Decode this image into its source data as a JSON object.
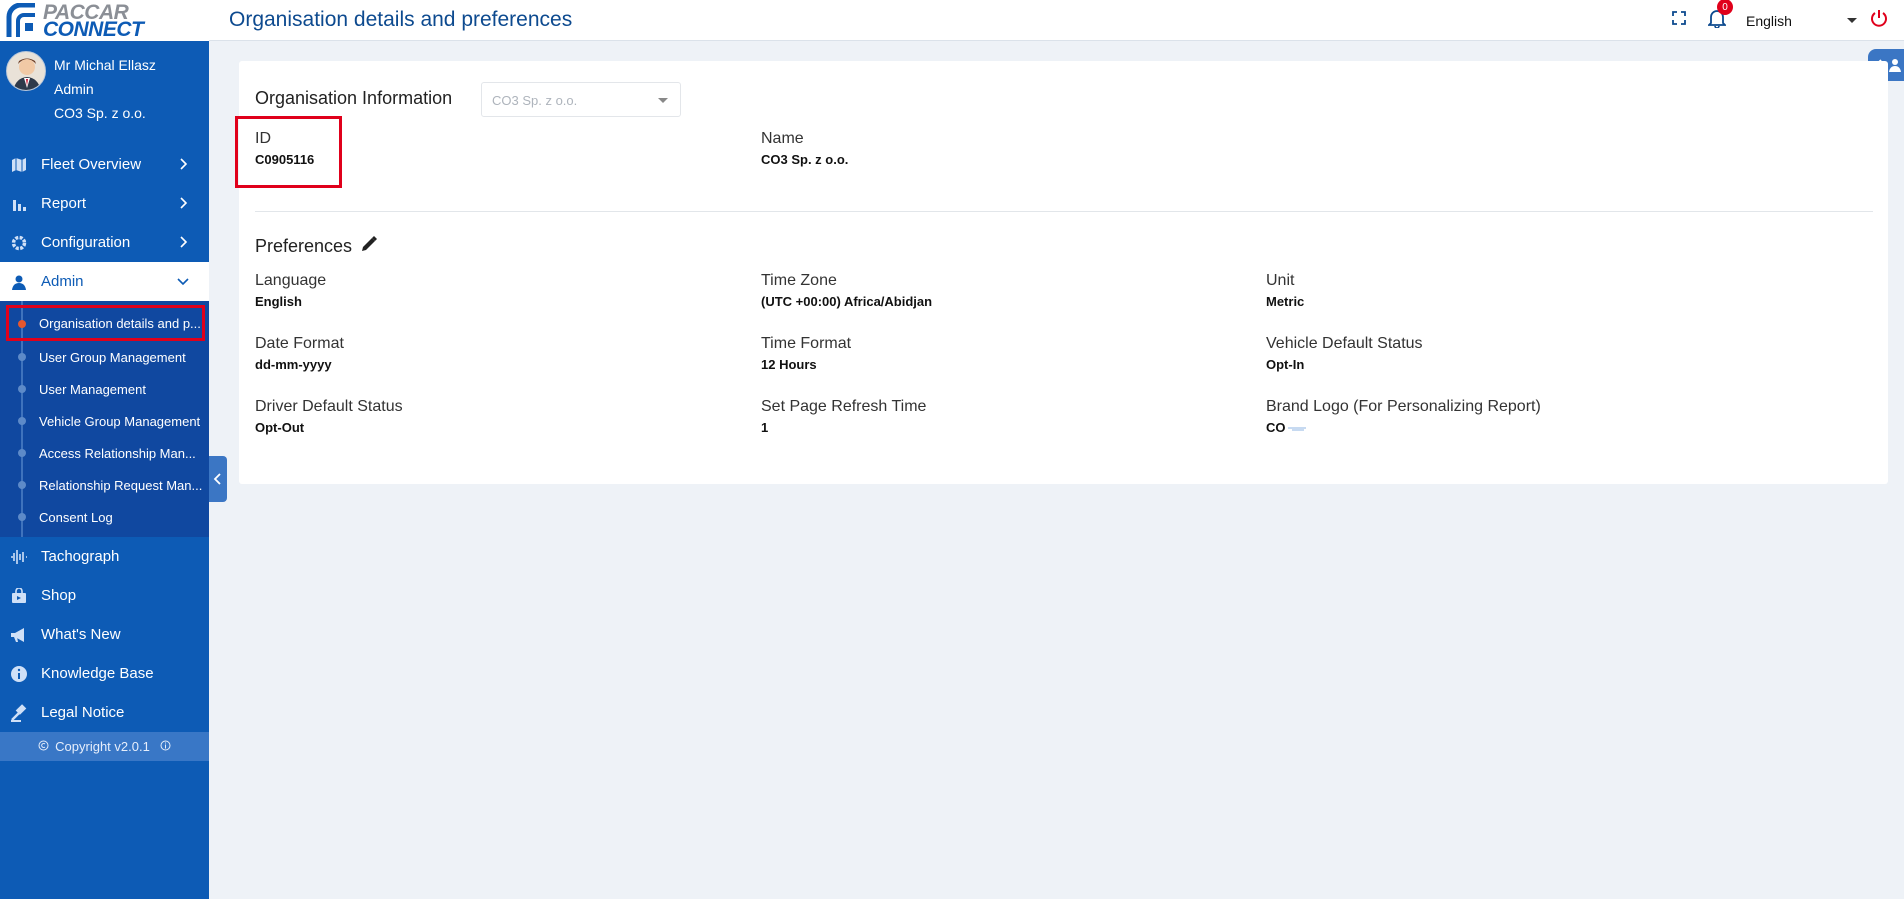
{
  "brand": {
    "line1": "PACCAR",
    "line2": "CONNECT"
  },
  "header": {
    "title": "Organisation details and preferences",
    "notifications": "0",
    "language": "English"
  },
  "user": {
    "name": "Mr Michal Ellasz",
    "role": "Admin",
    "org": "CO3 Sp. z o.o."
  },
  "nav": {
    "fleet": "Fleet Overview",
    "report": "Report",
    "config": "Configuration",
    "admin": "Admin",
    "sub": [
      "Organisation details and p...",
      "User Group Management",
      "User Management",
      "Vehicle Group Management",
      "Access Relationship Man...",
      "Relationship Request Man...",
      "Consent Log"
    ],
    "tachograph": "Tachograph",
    "shop": "Shop",
    "whatsnew": "What's New",
    "kb": "Knowledge Base",
    "legal": "Legal Notice"
  },
  "copyright": "Copyright v2.0.1",
  "org": {
    "title": "Organisation Information",
    "select_value": "CO3 Sp. z o.o.",
    "id_label": "ID",
    "id_value": "C0905116",
    "name_label": "Name",
    "name_value": "CO3 Sp. z o.o."
  },
  "prefs": {
    "title": "Preferences",
    "fields": [
      {
        "label": "Language",
        "value": "English"
      },
      {
        "label": "Time Zone",
        "value": "(UTC +00:00) Africa/Abidjan"
      },
      {
        "label": "Unit",
        "value": "Metric"
      },
      {
        "label": "Date Format",
        "value": "dd-mm-yyyy"
      },
      {
        "label": "Time Format",
        "value": "12 Hours"
      },
      {
        "label": "Vehicle Default Status",
        "value": "Opt-In"
      },
      {
        "label": "Driver Default Status",
        "value": "Opt-Out"
      },
      {
        "label": "Set Page Refresh Time",
        "value": "1"
      },
      {
        "label": "Brand Logo (For Personalizing Report)",
        "value": ""
      }
    ],
    "brand_logo_text": "CO"
  }
}
